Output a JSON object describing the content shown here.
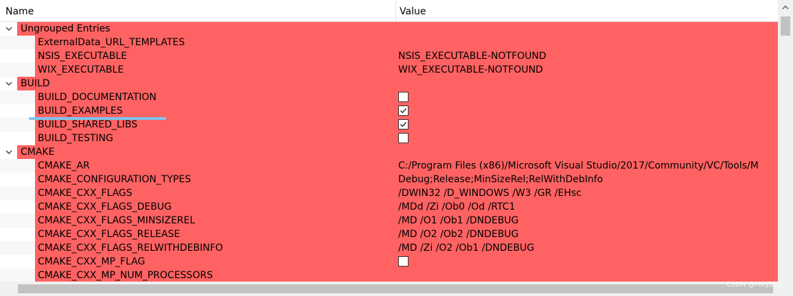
{
  "header": {
    "name_col": "Name",
    "value_col": "Value"
  },
  "rows": [
    {
      "type": "group",
      "label": "Ungrouped Entries"
    },
    {
      "type": "item",
      "label": "ExternalData_URL_TEMPLATES",
      "value": ""
    },
    {
      "type": "item",
      "label": "NSIS_EXECUTABLE",
      "value": "NSIS_EXECUTABLE-NOTFOUND"
    },
    {
      "type": "item",
      "label": "WIX_EXECUTABLE",
      "value": "WIX_EXECUTABLE-NOTFOUND"
    },
    {
      "type": "group",
      "label": "BUILD"
    },
    {
      "type": "item",
      "label": "BUILD_DOCUMENTATION",
      "checkbox": true,
      "checked": false
    },
    {
      "type": "item",
      "label": "BUILD_EXAMPLES",
      "checkbox": true,
      "checked": true
    },
    {
      "type": "item",
      "label": "BUILD_SHARED_LIBS",
      "checkbox": true,
      "checked": true
    },
    {
      "type": "item",
      "label": "BUILD_TESTING",
      "checkbox": true,
      "checked": false
    },
    {
      "type": "group",
      "label": "CMAKE"
    },
    {
      "type": "item",
      "label": "CMAKE_AR",
      "value": "C:/Program Files (x86)/Microsoft Visual Studio/2017/Community/VC/Tools/M"
    },
    {
      "type": "item",
      "label": "CMAKE_CONFIGURATION_TYPES",
      "value": "Debug;Release;MinSizeRel;RelWithDebInfo"
    },
    {
      "type": "item",
      "label": "CMAKE_CXX_FLAGS",
      "value": "/DWIN32 /D_WINDOWS /W3 /GR /EHsc"
    },
    {
      "type": "item",
      "label": "CMAKE_CXX_FLAGS_DEBUG",
      "value": "/MDd /Zi /Ob0 /Od /RTC1"
    },
    {
      "type": "item",
      "label": "CMAKE_CXX_FLAGS_MINSIZEREL",
      "value": "/MD /O1 /Ob1 /DNDEBUG"
    },
    {
      "type": "item",
      "label": "CMAKE_CXX_FLAGS_RELEASE",
      "value": "/MD /O2 /Ob2 /DNDEBUG"
    },
    {
      "type": "item",
      "label": "CMAKE_CXX_FLAGS_RELWITHDEBINFO",
      "value": "/MD /Zi /O2 /Ob1 /DNDEBUG"
    },
    {
      "type": "item",
      "label": "CMAKE_CXX_MP_FLAG",
      "checkbox": true,
      "checked": false
    },
    {
      "type": "item",
      "label": "CMAKE_CXX_MP_NUM_PROCESSORS",
      "value": ""
    }
  ],
  "watermark": "CSDN @HBybhy",
  "colors": {
    "row_highlight": "#ff6262",
    "annotation_line": "#7cc4ef"
  }
}
